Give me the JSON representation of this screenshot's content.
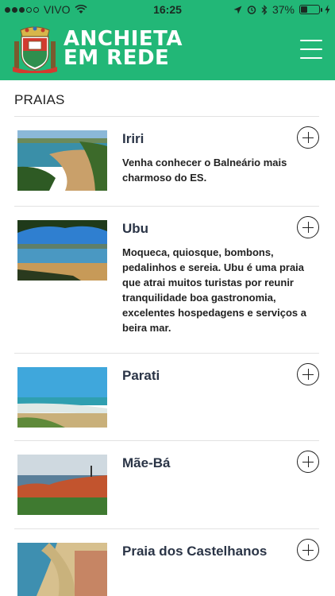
{
  "status_bar": {
    "carrier": "VIVO",
    "time": "16:25",
    "battery_percent": "37%",
    "battery_level": 0.37,
    "icons": [
      "signal-dots-icon",
      "wifi-icon",
      "location-arrow-icon",
      "alarm-icon",
      "bluetooth-icon",
      "battery-icon",
      "charging-bolt-icon"
    ]
  },
  "header": {
    "brand_line1": "ANCHIETA",
    "brand_line2": "EM REDE",
    "logo": "coat-of-arms-logo",
    "menu_icon": "hamburger-menu-icon",
    "colors": {
      "header_bg": "#22b777",
      "title_text": "#2a3446"
    }
  },
  "section": {
    "title": "PRAIAS"
  },
  "beaches": [
    {
      "name": "Iriri",
      "description": "Venha conhecer o Balneário mais charmoso do ES.",
      "action_icon": "plus-circle-icon"
    },
    {
      "name": "Ubu",
      "description": "Moqueca, quiosque, bombons, pedalinhos e sereia. Ubu é uma praia que atrai muitos turistas por reunir tranquilidade boa gastronomia, excelentes hospedagens e serviços a beira mar.",
      "action_icon": "plus-circle-icon"
    },
    {
      "name": "Parati",
      "description": "",
      "action_icon": "plus-circle-icon"
    },
    {
      "name": "Mãe-Bá",
      "description": "",
      "action_icon": "plus-circle-icon"
    },
    {
      "name": "Praia dos Castelhanos",
      "description": "",
      "action_icon": "plus-circle-icon"
    }
  ]
}
